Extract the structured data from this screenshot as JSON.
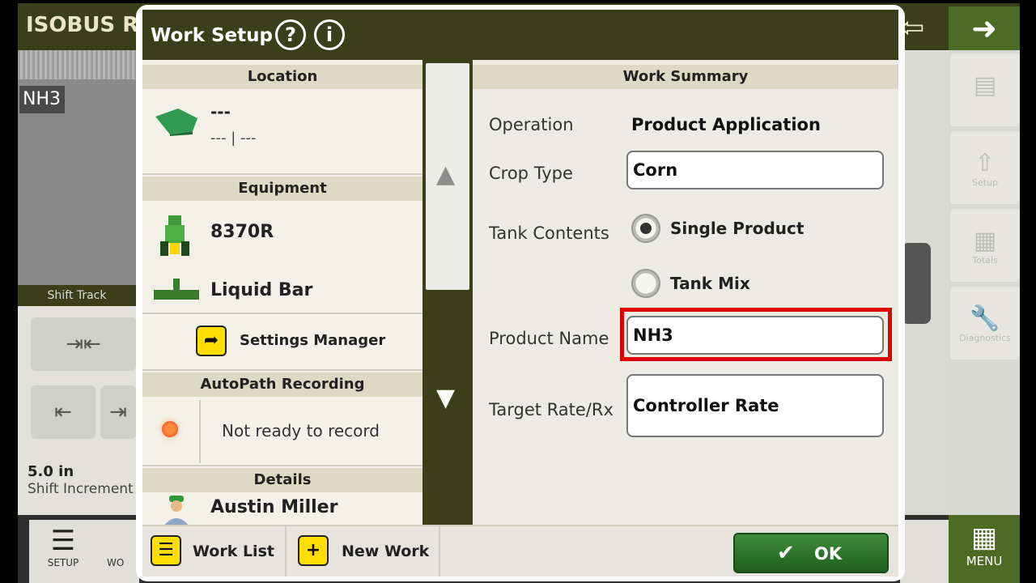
{
  "background": {
    "app_title": "ISOBUS Ru",
    "nh3_badge": "NH3",
    "shift_track_title": "Shift Track",
    "shift_value": "5.0 in",
    "shift_label": "Shift Increment",
    "setup_label": "SETUP",
    "wo_label": "WO",
    "menu_label": "MENU",
    "side_tiles": [
      "Setup",
      "Totals",
      "Diagnostics"
    ]
  },
  "modal": {
    "title": "Work Setup",
    "help_icon": "?",
    "info_icon": "i"
  },
  "location": {
    "header": "Location",
    "name": "---",
    "sub": "--- | ---"
  },
  "equipment": {
    "header": "Equipment",
    "tractor": "8370R",
    "implement": "Liquid Bar",
    "settings_manager": "Settings Manager"
  },
  "autopath": {
    "header": "AutoPath Recording",
    "status": "Not ready to record"
  },
  "details": {
    "header": "Details",
    "operator": "Austin Miller"
  },
  "work_summary": {
    "header": "Work Summary",
    "operation_label": "Operation",
    "operation_value": "Product Application",
    "crop_type_label": "Crop Type",
    "crop_type_value": "Corn",
    "tank_contents_label": "Tank Contents",
    "option_single": "Single Product",
    "option_mix": "Tank Mix",
    "selected_option": "Single Product",
    "product_name_label": "Product Name",
    "product_name_value": "NH3",
    "target_rate_label": "Target Rate/Rx",
    "target_rate_value": "Controller Rate"
  },
  "footer": {
    "work_list": "Work List",
    "new_work": "New Work",
    "ok": "OK"
  }
}
